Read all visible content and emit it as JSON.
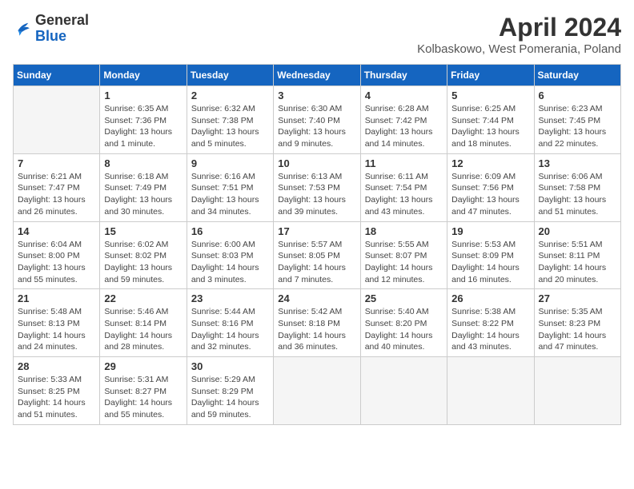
{
  "logo": {
    "general": "General",
    "blue": "Blue"
  },
  "title": "April 2024",
  "location": "Kolbaskowo, West Pomerania, Poland",
  "days_of_week": [
    "Sunday",
    "Monday",
    "Tuesday",
    "Wednesday",
    "Thursday",
    "Friday",
    "Saturday"
  ],
  "weeks": [
    [
      {
        "day": "",
        "info": ""
      },
      {
        "day": "1",
        "sunrise": "Sunrise: 6:35 AM",
        "sunset": "Sunset: 7:36 PM",
        "daylight": "Daylight: 13 hours and 1 minute."
      },
      {
        "day": "2",
        "sunrise": "Sunrise: 6:32 AM",
        "sunset": "Sunset: 7:38 PM",
        "daylight": "Daylight: 13 hours and 5 minutes."
      },
      {
        "day": "3",
        "sunrise": "Sunrise: 6:30 AM",
        "sunset": "Sunset: 7:40 PM",
        "daylight": "Daylight: 13 hours and 9 minutes."
      },
      {
        "day": "4",
        "sunrise": "Sunrise: 6:28 AM",
        "sunset": "Sunset: 7:42 PM",
        "daylight": "Daylight: 13 hours and 14 minutes."
      },
      {
        "day": "5",
        "sunrise": "Sunrise: 6:25 AM",
        "sunset": "Sunset: 7:44 PM",
        "daylight": "Daylight: 13 hours and 18 minutes."
      },
      {
        "day": "6",
        "sunrise": "Sunrise: 6:23 AM",
        "sunset": "Sunset: 7:45 PM",
        "daylight": "Daylight: 13 hours and 22 minutes."
      }
    ],
    [
      {
        "day": "7",
        "sunrise": "Sunrise: 6:21 AM",
        "sunset": "Sunset: 7:47 PM",
        "daylight": "Daylight: 13 hours and 26 minutes."
      },
      {
        "day": "8",
        "sunrise": "Sunrise: 6:18 AM",
        "sunset": "Sunset: 7:49 PM",
        "daylight": "Daylight: 13 hours and 30 minutes."
      },
      {
        "day": "9",
        "sunrise": "Sunrise: 6:16 AM",
        "sunset": "Sunset: 7:51 PM",
        "daylight": "Daylight: 13 hours and 34 minutes."
      },
      {
        "day": "10",
        "sunrise": "Sunrise: 6:13 AM",
        "sunset": "Sunset: 7:53 PM",
        "daylight": "Daylight: 13 hours and 39 minutes."
      },
      {
        "day": "11",
        "sunrise": "Sunrise: 6:11 AM",
        "sunset": "Sunset: 7:54 PM",
        "daylight": "Daylight: 13 hours and 43 minutes."
      },
      {
        "day": "12",
        "sunrise": "Sunrise: 6:09 AM",
        "sunset": "Sunset: 7:56 PM",
        "daylight": "Daylight: 13 hours and 47 minutes."
      },
      {
        "day": "13",
        "sunrise": "Sunrise: 6:06 AM",
        "sunset": "Sunset: 7:58 PM",
        "daylight": "Daylight: 13 hours and 51 minutes."
      }
    ],
    [
      {
        "day": "14",
        "sunrise": "Sunrise: 6:04 AM",
        "sunset": "Sunset: 8:00 PM",
        "daylight": "Daylight: 13 hours and 55 minutes."
      },
      {
        "day": "15",
        "sunrise": "Sunrise: 6:02 AM",
        "sunset": "Sunset: 8:02 PM",
        "daylight": "Daylight: 13 hours and 59 minutes."
      },
      {
        "day": "16",
        "sunrise": "Sunrise: 6:00 AM",
        "sunset": "Sunset: 8:03 PM",
        "daylight": "Daylight: 14 hours and 3 minutes."
      },
      {
        "day": "17",
        "sunrise": "Sunrise: 5:57 AM",
        "sunset": "Sunset: 8:05 PM",
        "daylight": "Daylight: 14 hours and 7 minutes."
      },
      {
        "day": "18",
        "sunrise": "Sunrise: 5:55 AM",
        "sunset": "Sunset: 8:07 PM",
        "daylight": "Daylight: 14 hours and 12 minutes."
      },
      {
        "day": "19",
        "sunrise": "Sunrise: 5:53 AM",
        "sunset": "Sunset: 8:09 PM",
        "daylight": "Daylight: 14 hours and 16 minutes."
      },
      {
        "day": "20",
        "sunrise": "Sunrise: 5:51 AM",
        "sunset": "Sunset: 8:11 PM",
        "daylight": "Daylight: 14 hours and 20 minutes."
      }
    ],
    [
      {
        "day": "21",
        "sunrise": "Sunrise: 5:48 AM",
        "sunset": "Sunset: 8:13 PM",
        "daylight": "Daylight: 14 hours and 24 minutes."
      },
      {
        "day": "22",
        "sunrise": "Sunrise: 5:46 AM",
        "sunset": "Sunset: 8:14 PM",
        "daylight": "Daylight: 14 hours and 28 minutes."
      },
      {
        "day": "23",
        "sunrise": "Sunrise: 5:44 AM",
        "sunset": "Sunset: 8:16 PM",
        "daylight": "Daylight: 14 hours and 32 minutes."
      },
      {
        "day": "24",
        "sunrise": "Sunrise: 5:42 AM",
        "sunset": "Sunset: 8:18 PM",
        "daylight": "Daylight: 14 hours and 36 minutes."
      },
      {
        "day": "25",
        "sunrise": "Sunrise: 5:40 AM",
        "sunset": "Sunset: 8:20 PM",
        "daylight": "Daylight: 14 hours and 40 minutes."
      },
      {
        "day": "26",
        "sunrise": "Sunrise: 5:38 AM",
        "sunset": "Sunset: 8:22 PM",
        "daylight": "Daylight: 14 hours and 43 minutes."
      },
      {
        "day": "27",
        "sunrise": "Sunrise: 5:35 AM",
        "sunset": "Sunset: 8:23 PM",
        "daylight": "Daylight: 14 hours and 47 minutes."
      }
    ],
    [
      {
        "day": "28",
        "sunrise": "Sunrise: 5:33 AM",
        "sunset": "Sunset: 8:25 PM",
        "daylight": "Daylight: 14 hours and 51 minutes."
      },
      {
        "day": "29",
        "sunrise": "Sunrise: 5:31 AM",
        "sunset": "Sunset: 8:27 PM",
        "daylight": "Daylight: 14 hours and 55 minutes."
      },
      {
        "day": "30",
        "sunrise": "Sunrise: 5:29 AM",
        "sunset": "Sunset: 8:29 PM",
        "daylight": "Daylight: 14 hours and 59 minutes."
      },
      {
        "day": "",
        "info": ""
      },
      {
        "day": "",
        "info": ""
      },
      {
        "day": "",
        "info": ""
      },
      {
        "day": "",
        "info": ""
      }
    ]
  ]
}
